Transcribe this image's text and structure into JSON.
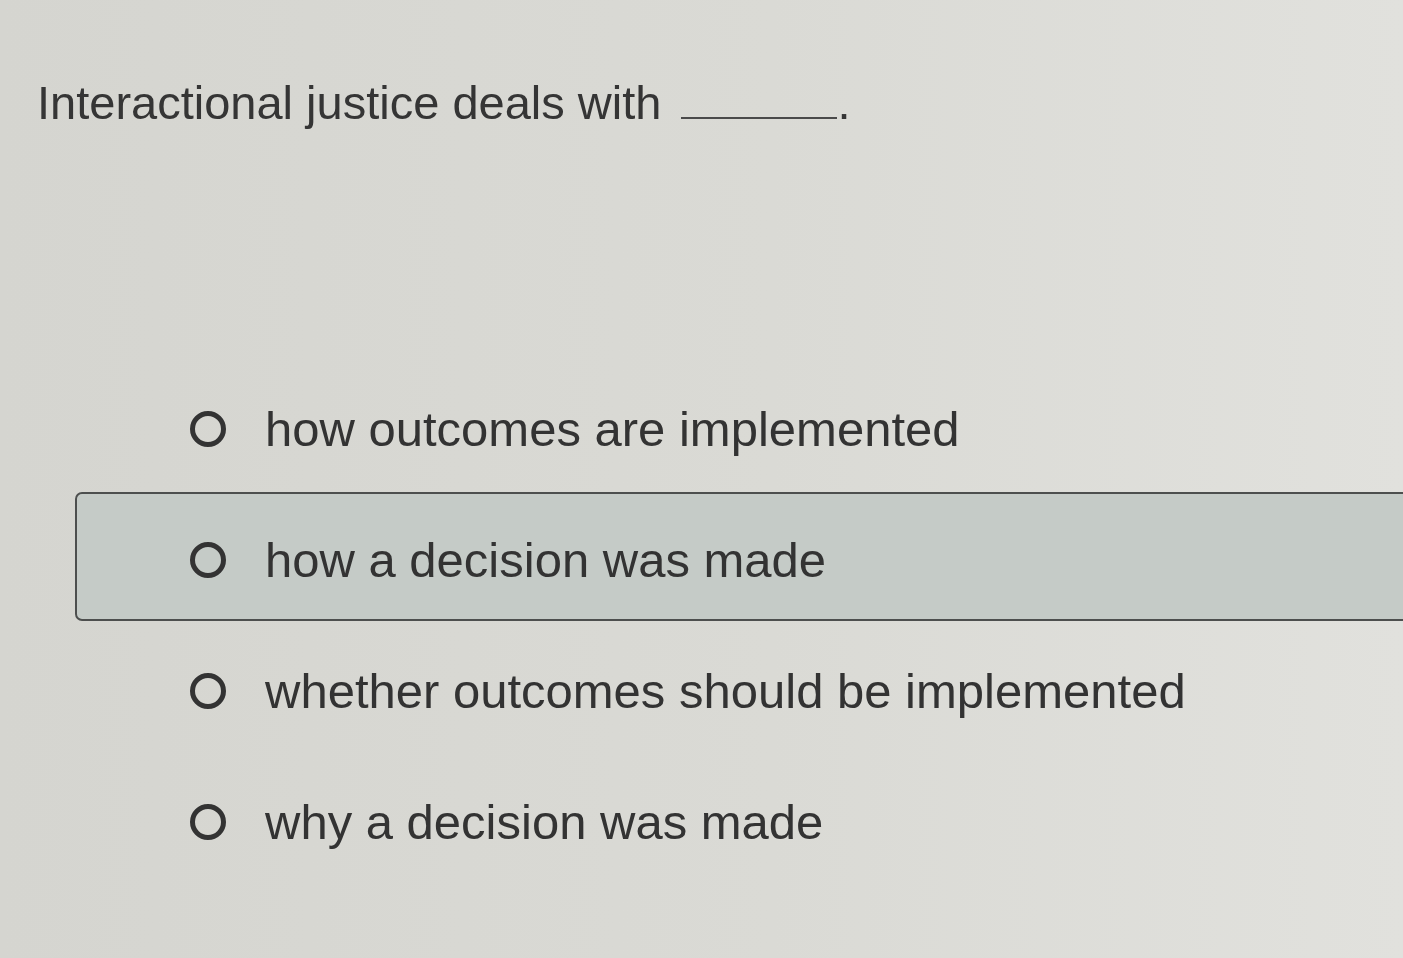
{
  "question": {
    "parts": [
      {
        "kind": "text",
        "text": "Interactional justice deals with"
      },
      {
        "kind": "blank"
      },
      {
        "kind": "text",
        "text": "."
      }
    ]
  },
  "options": [
    {
      "label": "how outcomes are implemented",
      "selected": false,
      "highlighted": false
    },
    {
      "label": "how a decision was made",
      "selected": false,
      "highlighted": true
    },
    {
      "label": "whether outcomes should be implemented",
      "selected": false,
      "highlighted": false
    },
    {
      "label": "why a decision was made",
      "selected": false,
      "highlighted": false
    }
  ]
}
